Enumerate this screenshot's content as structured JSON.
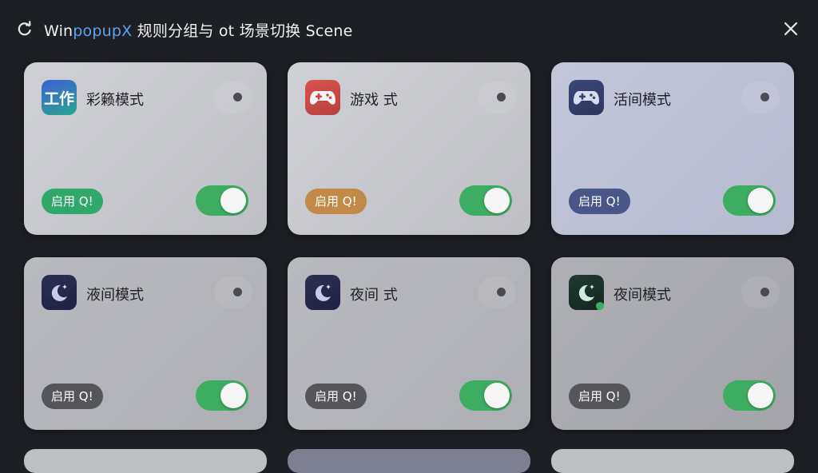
{
  "window": {
    "title_prefix": "Win",
    "title_accent": "popupX",
    "title_rest": " 规则分组与 ot 场景切换 Scene",
    "refresh_icon": "refresh-icon",
    "close_icon": "close-icon"
  },
  "cards": [
    {
      "title": "彩籁模式",
      "icon": "work-text-icon",
      "icon_text": "工作",
      "pill": "启用 Q!",
      "pill_color": "#2fa86a",
      "enabled": true
    },
    {
      "title": "游戏 式",
      "icon": "gamepad-icon",
      "pill": "启用 Q!",
      "pill_color": "#c18a48",
      "enabled": true
    },
    {
      "title": "活间模式",
      "icon": "gamepad-icon",
      "pill": "启用 Q!",
      "pill_color": "#4a5588",
      "enabled": true
    },
    {
      "title": "液间模式",
      "icon": "moon-star-icon",
      "pill": "启用 Q!",
      "pill_color": "#55565c",
      "enabled": true
    },
    {
      "title": "夜间 式",
      "icon": "moon-star-icon",
      "pill": "启用 Q!",
      "pill_color": "#55565c",
      "enabled": true
    },
    {
      "title": "夜间模式",
      "icon": "moon-star-icon",
      "pill": "启用 Q!",
      "pill_color": "#55565c",
      "enabled": true
    }
  ],
  "colors": {
    "background": "#1d1f25",
    "accent": "#5aa2f5",
    "toggle_on": "#3dad62"
  }
}
